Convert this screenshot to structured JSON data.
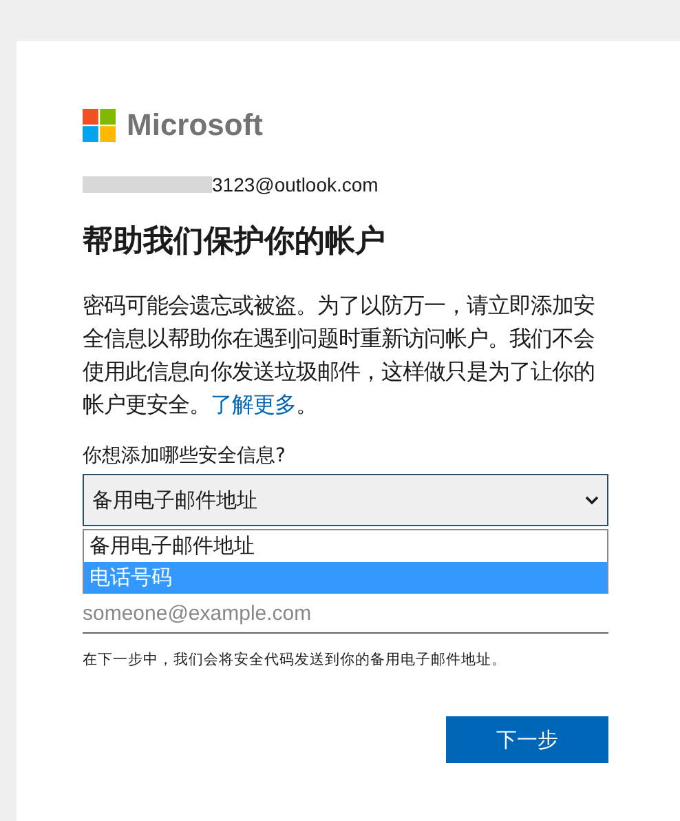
{
  "brand": {
    "name": "Microsoft"
  },
  "account": {
    "email": "3123@outlook.com"
  },
  "title": "帮助我们保护你的帐户",
  "description": "密码可能会遗忘或被盗。为了以防万一，请立即添加安全信息以帮助你在遇到问题时重新访问帐户。我们不会使用此信息向你发送垃圾邮件，这样做只是为了让你的帐户更安全。",
  "learn_more": "了解更多",
  "learn_more_suffix": "。",
  "question": "你想添加哪些安全信息?",
  "select": {
    "value": "备用电子邮件地址",
    "expanded": true,
    "options": [
      {
        "label": "备用电子邮件地址",
        "highlighted": false
      },
      {
        "label": "电话号码",
        "highlighted": true
      }
    ]
  },
  "email_field": {
    "placeholder": "someone@example.com"
  },
  "note": "在下一步中，我们会将安全代码发送到你的备用电子邮件地址。",
  "next_button": "下一步"
}
